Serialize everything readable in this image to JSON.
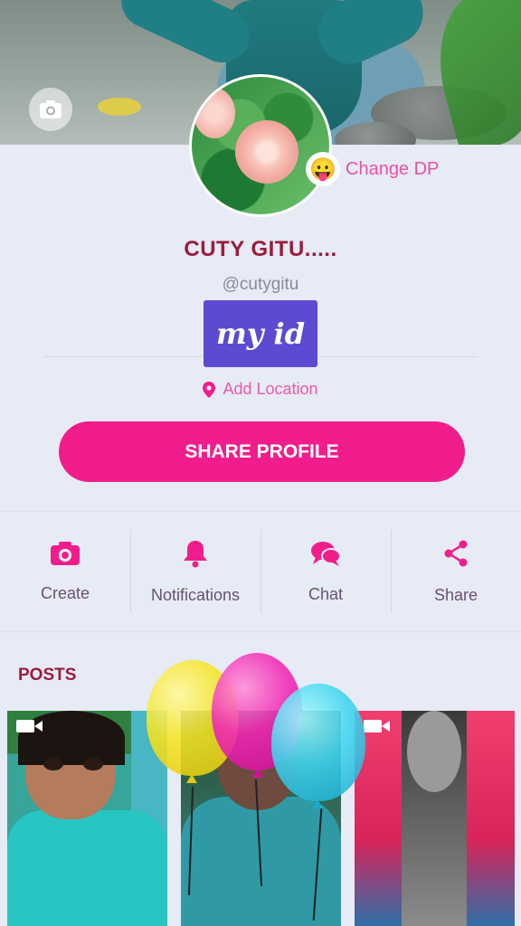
{
  "cover": {
    "camera_icon": "camera-icon"
  },
  "avatar": {
    "change_dp_label": "Change DP",
    "emoji": "😛"
  },
  "profile": {
    "name": "CUTY GITU.....",
    "handle": "@cutygitu",
    "overlay_label": "my id",
    "location_label": "Add Location"
  },
  "share_profile_label": "SHARE PROFILE",
  "actions": [
    {
      "label": "Create",
      "icon": "camera-icon"
    },
    {
      "label": "Notifications",
      "icon": "bell-icon"
    },
    {
      "label": "Chat",
      "icon": "chat-icon"
    },
    {
      "label": "Share",
      "icon": "share-icon"
    }
  ],
  "posts": {
    "title": "POSTS"
  },
  "colors": {
    "accent": "#f21d8c",
    "name": "#9b1b3c",
    "overlay": "#5b4bd0"
  }
}
